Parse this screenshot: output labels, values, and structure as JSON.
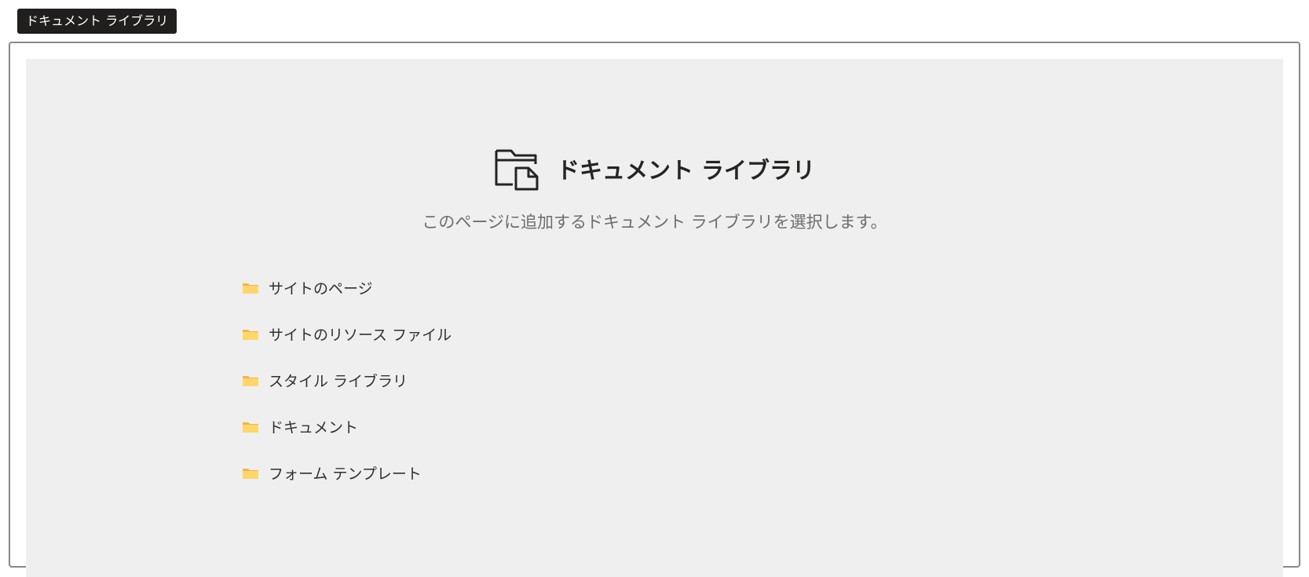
{
  "webpart": {
    "tag_label": "ドキュメント ライブラリ"
  },
  "placeholder": {
    "icon": "document-library-icon",
    "title": "ドキュメント ライブラリ",
    "description": "このページに追加するドキュメント ライブラリを選択します。"
  },
  "libraries": [
    {
      "icon": "folder-icon",
      "label": "サイトのページ"
    },
    {
      "icon": "folder-icon",
      "label": "サイトのリソース ファイル"
    },
    {
      "icon": "folder-icon",
      "label": "スタイル ライブラリ"
    },
    {
      "icon": "folder-icon",
      "label": "ドキュメント"
    },
    {
      "icon": "folder-icon",
      "label": "フォーム テンプレート"
    }
  ],
  "colors": {
    "tag_background": "#201f1e",
    "placeholder_background": "#efefef",
    "folder_fill": "#ffd66b",
    "folder_back": "#f2b642"
  }
}
